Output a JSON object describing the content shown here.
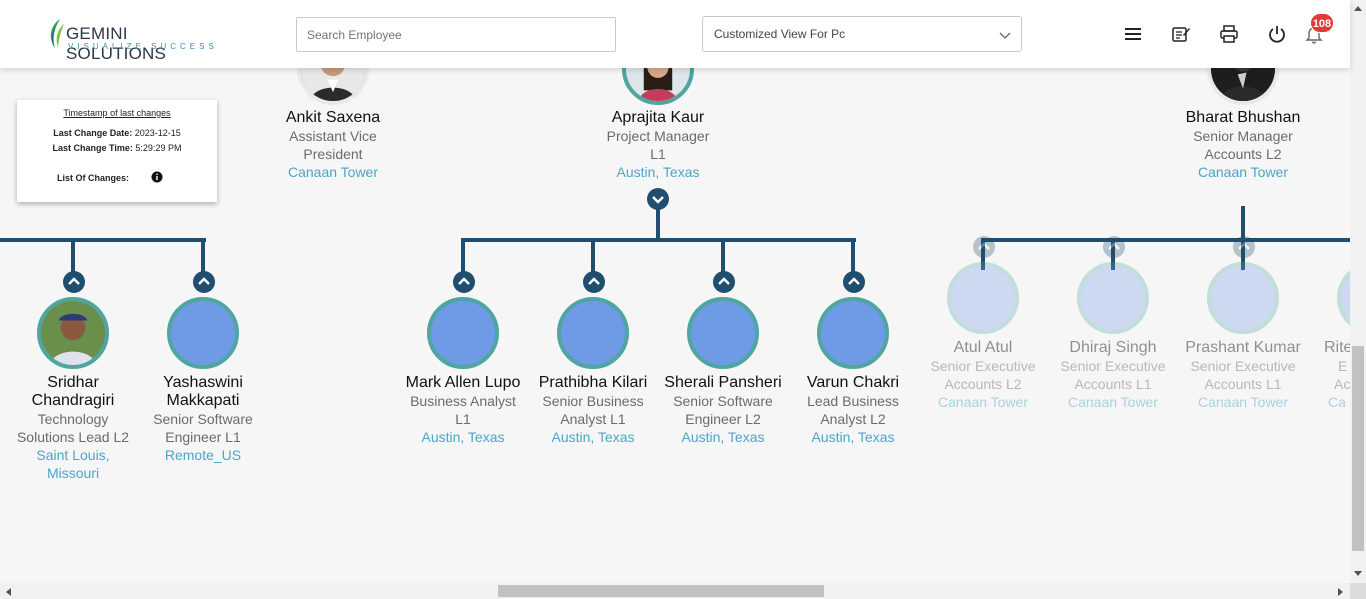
{
  "header": {
    "logo_text": "GEMINI SOLUTIONS",
    "logo_tagline": "VISUALIZE SUCCESS",
    "search_placeholder": "Search Employee",
    "view_select_value": "Customized View For Pc",
    "notification_count": "108",
    "icons": [
      "menu-icon",
      "edit-list-icon",
      "print-icon",
      "power-icon",
      "bell-icon"
    ]
  },
  "timestamp_card": {
    "title": "Timestamp of last changes",
    "date_label": "Last Change Date:",
    "date_value": "2023-12-15",
    "time_label": "Last Change Time:",
    "time_value": "5:29:29 PM",
    "list_label": "List Of Changes:"
  },
  "colors": {
    "accent_line": "#1f4e6e",
    "avatar_border": "#4fa6a0",
    "avatar_fill": "#6f9ae6",
    "location_text": "#4aa6c7",
    "badge": "#e53935"
  },
  "top_employees": [
    {
      "name": "Ankit Saxena",
      "role_lines": [
        "Assistant Vice",
        "President"
      ],
      "location_lines": [
        "Canaan Tower"
      ]
    },
    {
      "name": "Aprajita Kaur",
      "role_lines": [
        "Project Manager",
        "L1"
      ],
      "location_lines": [
        "Austin, Texas"
      ]
    },
    {
      "name": "Bharat Bhushan",
      "role_lines": [
        "Senior Manager",
        "Accounts L2"
      ],
      "location_lines": [
        "Canaan Tower"
      ]
    }
  ],
  "left_reports": [
    {
      "name_lines": [
        "Sridhar",
        "Chandragiri"
      ],
      "role_lines": [
        "Technology",
        "Solutions Lead L2"
      ],
      "location_lines": [
        "Saint Louis,",
        "Missouri"
      ]
    },
    {
      "name_lines": [
        "Yashaswini",
        "Makkapati"
      ],
      "role_lines": [
        "Senior Software",
        "Engineer L1"
      ],
      "location_lines": [
        "Remote_US"
      ]
    }
  ],
  "middle_reports": [
    {
      "name_lines": [
        "Mark Allen Lupo"
      ],
      "role_lines": [
        "Business Analyst",
        "L1"
      ],
      "location_lines": [
        "Austin, Texas"
      ]
    },
    {
      "name_lines": [
        "Prathibha Kilari"
      ],
      "role_lines": [
        "Senior Business",
        "Analyst L1"
      ],
      "location_lines": [
        "Austin, Texas"
      ]
    },
    {
      "name_lines": [
        "Sherali Pansheri"
      ],
      "role_lines": [
        "Senior Software",
        "Engineer L2"
      ],
      "location_lines": [
        "Austin, Texas"
      ]
    },
    {
      "name_lines": [
        "Varun Chakri"
      ],
      "role_lines": [
        "Lead Business",
        "Analyst L2"
      ],
      "location_lines": [
        "Austin, Texas"
      ]
    }
  ],
  "right_reports": [
    {
      "name_lines": [
        "Atul Atul"
      ],
      "role_lines": [
        "Senior Executive",
        "Accounts L2"
      ],
      "location_lines": [
        "Canaan Tower"
      ]
    },
    {
      "name_lines": [
        "Dhiraj Singh"
      ],
      "role_lines": [
        "Senior Executive",
        "Accounts L1"
      ],
      "location_lines": [
        "Canaan Tower"
      ]
    },
    {
      "name_lines": [
        "Prashant Kumar"
      ],
      "role_lines": [
        "Senior Executive",
        "Accounts L1"
      ],
      "location_lines": [
        "Canaan Tower"
      ]
    },
    {
      "name_lines": [
        "Rite"
      ],
      "role_lines": [
        "E",
        "Ac"
      ],
      "location_lines": [
        "Ca"
      ]
    }
  ]
}
